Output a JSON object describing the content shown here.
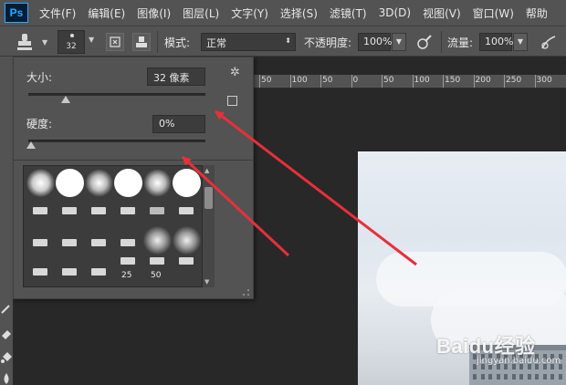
{
  "menubar": {
    "logo": "Ps",
    "items": [
      "文件(F)",
      "编辑(E)",
      "图像(I)",
      "图层(L)",
      "文字(Y)",
      "选择(S)",
      "滤镜(T)",
      "3D(D)",
      "视图(V)",
      "窗口(W)",
      "帮助"
    ]
  },
  "options_bar": {
    "brush_size": "32",
    "mode_label": "模式:",
    "mode_value": "正常",
    "opacity_label": "不透明度:",
    "opacity_value": "100%",
    "flow_label": "流量:",
    "flow_value": "100%"
  },
  "ruler": {
    "ticks": [
      "50",
      "100",
      "50",
      "0",
      "50",
      "100",
      "150",
      "200",
      "250",
      "300"
    ]
  },
  "brush_panel": {
    "size_label": "大小:",
    "size_value": "32 像素",
    "size_level": 0.08,
    "hardness_label": "硬度:",
    "hardness_value": "0%",
    "hardness_level": 0.0,
    "preset_labels": [
      "25",
      "50"
    ]
  },
  "watermark": {
    "brand": "Baidu经验",
    "sub": "jingyan.baidu.com"
  },
  "colors": {
    "annotation_arrow": "#e8303a",
    "ui_dark": "#535353",
    "workspace": "#282828"
  }
}
